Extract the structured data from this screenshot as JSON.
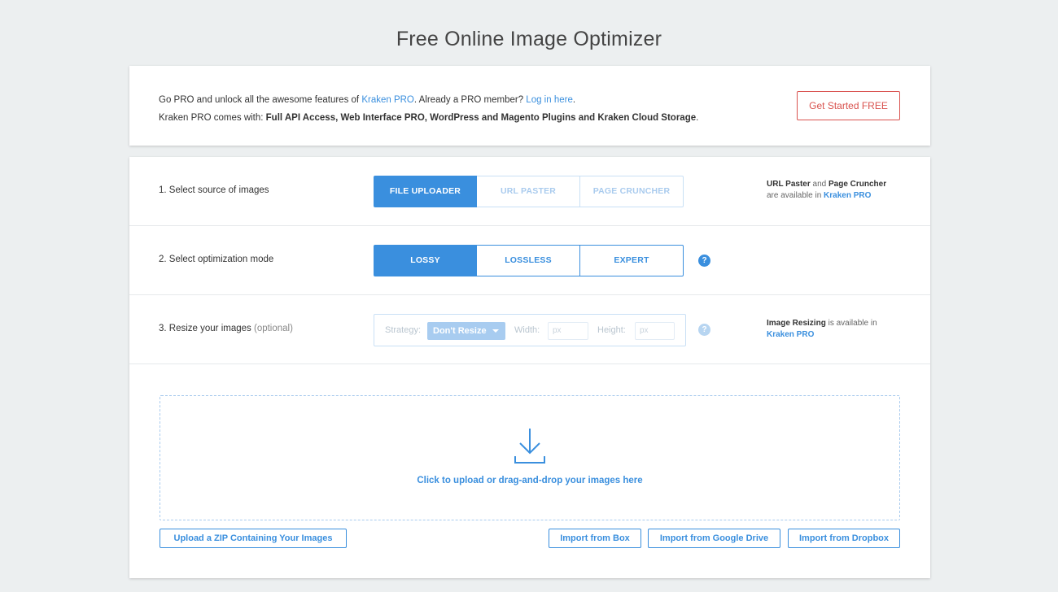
{
  "page": {
    "title": "Free Online Image Optimizer"
  },
  "promo": {
    "line1_prefix": "Go PRO and unlock all the awesome features of ",
    "line1_link": "Kraken PRO",
    "line1_middle": ". Already a PRO member? ",
    "line1_login": "Log in here",
    "line1_suffix": ".",
    "line2_prefix": "Kraken PRO comes with: ",
    "line2_bold": "Full API Access, Web Interface PRO, WordPress and Magento Plugins and Kraken Cloud Storage",
    "line2_suffix": ".",
    "cta_label": "Get Started FREE"
  },
  "source": {
    "label": "1. Select source of images",
    "options": [
      "FILE UPLOADER",
      "URL PASTER",
      "PAGE CRUNCHER"
    ],
    "selected": "FILE UPLOADER",
    "note_bold1": "URL Paster",
    "note_and": " and ",
    "note_bold2": "Page Cruncher",
    "note_line2": "are available in ",
    "note_link": "Kraken PRO"
  },
  "mode": {
    "label": "2. Select optimization mode",
    "options": [
      "LOSSY",
      "LOSSLESS",
      "EXPERT"
    ],
    "selected": "LOSSY",
    "help_icon": "?"
  },
  "resize": {
    "label": "3. Resize your images",
    "label_optional": "(optional)",
    "strategy_label": "Strategy:",
    "strategy_value": "Don't Resize",
    "width_label": "Width:",
    "width_placeholder": "px",
    "height_label": "Height:",
    "height_placeholder": "px",
    "help_icon": "?",
    "note_bold": "Image Resizing",
    "note_text": " is available in",
    "note_link": "Kraken PRO"
  },
  "upload": {
    "dropzone_text": "Click to upload or drag-and-drop your images here",
    "zip_button": "Upload a ZIP Containing Your Images",
    "box_button": "Import from Box",
    "gdrive_button": "Import from Google Drive",
    "dropbox_button": "Import from Dropbox"
  },
  "colors": {
    "accent": "#3a8fde",
    "cta": "#d9534f",
    "background": "#eceff0"
  }
}
